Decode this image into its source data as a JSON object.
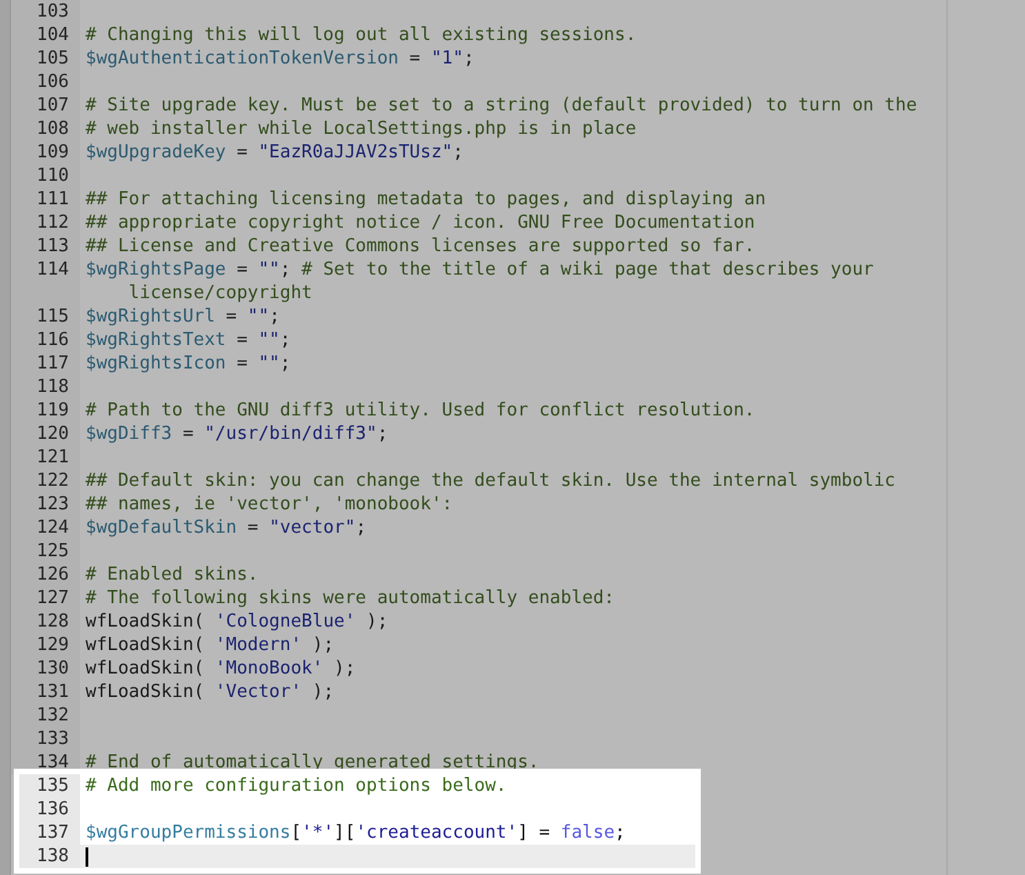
{
  "lines": [
    {
      "number": "103",
      "highlighted": false,
      "current": false
    },
    {
      "number": "104",
      "highlighted": false,
      "current": false,
      "segments": [
        {
          "kind": "comment",
          "text": "# Changing this will log out all existing sessions."
        }
      ]
    },
    {
      "number": "105",
      "highlighted": false,
      "current": false,
      "segments": [
        {
          "kind": "variable",
          "text": "$wgAuthenticationTokenVersion"
        },
        {
          "kind": "plain",
          "text": " = "
        },
        {
          "kind": "string",
          "text": "\"1\""
        },
        {
          "kind": "plain",
          "text": ";"
        }
      ]
    },
    {
      "number": "106",
      "highlighted": false,
      "current": false
    },
    {
      "number": "107",
      "highlighted": false,
      "current": false,
      "segments": [
        {
          "kind": "comment",
          "text": "# Site upgrade key. Must be set to a string (default provided) to turn on the"
        }
      ]
    },
    {
      "number": "108",
      "highlighted": false,
      "current": false,
      "segments": [
        {
          "kind": "comment",
          "text": "# web installer while LocalSettings.php is in place"
        }
      ]
    },
    {
      "number": "109",
      "highlighted": false,
      "current": false,
      "segments": [
        {
          "kind": "variable",
          "text": "$wgUpgradeKey"
        },
        {
          "kind": "plain",
          "text": " = "
        },
        {
          "kind": "string",
          "text": "\"EazR0aJJAV2sTUsz\""
        },
        {
          "kind": "plain",
          "text": ";"
        }
      ]
    },
    {
      "number": "110",
      "highlighted": false,
      "current": false
    },
    {
      "number": "111",
      "highlighted": false,
      "current": false,
      "segments": [
        {
          "kind": "comment",
          "text": "## For attaching licensing metadata to pages, and displaying an"
        }
      ]
    },
    {
      "number": "112",
      "highlighted": false,
      "current": false,
      "segments": [
        {
          "kind": "comment",
          "text": "## appropriate copyright notice / icon. GNU Free Documentation"
        }
      ]
    },
    {
      "number": "113",
      "highlighted": false,
      "current": false,
      "segments": [
        {
          "kind": "comment",
          "text": "## License and Creative Commons licenses are supported so far."
        }
      ]
    },
    {
      "number": "114",
      "highlighted": false,
      "current": false,
      "segments": [
        {
          "kind": "variable",
          "text": "$wgRightsPage"
        },
        {
          "kind": "plain",
          "text": " = "
        },
        {
          "kind": "string",
          "text": "\"\""
        },
        {
          "kind": "plain",
          "text": "; "
        },
        {
          "kind": "comment",
          "text": "# Set to the title of a wiki page that describes your"
        }
      ],
      "wrap": [
        {
          "kind": "comment",
          "text": "license/copyright"
        }
      ]
    },
    {
      "number": "115",
      "highlighted": false,
      "current": false,
      "segments": [
        {
          "kind": "variable",
          "text": "$wgRightsUrl"
        },
        {
          "kind": "plain",
          "text": " = "
        },
        {
          "kind": "string",
          "text": "\"\""
        },
        {
          "kind": "plain",
          "text": ";"
        }
      ]
    },
    {
      "number": "116",
      "highlighted": false,
      "current": false,
      "segments": [
        {
          "kind": "variable",
          "text": "$wgRightsText"
        },
        {
          "kind": "plain",
          "text": " = "
        },
        {
          "kind": "string",
          "text": "\"\""
        },
        {
          "kind": "plain",
          "text": ";"
        }
      ]
    },
    {
      "number": "117",
      "highlighted": false,
      "current": false,
      "segments": [
        {
          "kind": "variable",
          "text": "$wgRightsIcon"
        },
        {
          "kind": "plain",
          "text": " = "
        },
        {
          "kind": "string",
          "text": "\"\""
        },
        {
          "kind": "plain",
          "text": ";"
        }
      ]
    },
    {
      "number": "118",
      "highlighted": false,
      "current": false
    },
    {
      "number": "119",
      "highlighted": false,
      "current": false,
      "segments": [
        {
          "kind": "comment",
          "text": "# Path to the GNU diff3 utility. Used for conflict resolution."
        }
      ]
    },
    {
      "number": "120",
      "highlighted": false,
      "current": false,
      "segments": [
        {
          "kind": "variable",
          "text": "$wgDiff3"
        },
        {
          "kind": "plain",
          "text": " = "
        },
        {
          "kind": "string",
          "text": "\"/usr/bin/diff3\""
        },
        {
          "kind": "plain",
          "text": ";"
        }
      ]
    },
    {
      "number": "121",
      "highlighted": false,
      "current": false
    },
    {
      "number": "122",
      "highlighted": false,
      "current": false,
      "segments": [
        {
          "kind": "comment",
          "text": "## Default skin: you can change the default skin. Use the internal symbolic"
        }
      ]
    },
    {
      "number": "123",
      "highlighted": false,
      "current": false,
      "segments": [
        {
          "kind": "comment",
          "text": "## names, ie 'vector', 'monobook':"
        }
      ]
    },
    {
      "number": "124",
      "highlighted": false,
      "current": false,
      "segments": [
        {
          "kind": "variable",
          "text": "$wgDefaultSkin"
        },
        {
          "kind": "plain",
          "text": " = "
        },
        {
          "kind": "string",
          "text": "\"vector\""
        },
        {
          "kind": "plain",
          "text": ";"
        }
      ]
    },
    {
      "number": "125",
      "highlighted": false,
      "current": false
    },
    {
      "number": "126",
      "highlighted": false,
      "current": false,
      "segments": [
        {
          "kind": "comment",
          "text": "# Enabled skins."
        }
      ]
    },
    {
      "number": "127",
      "highlighted": false,
      "current": false,
      "segments": [
        {
          "kind": "comment",
          "text": "# The following skins were automatically enabled:"
        }
      ]
    },
    {
      "number": "128",
      "highlighted": false,
      "current": false,
      "segments": [
        {
          "kind": "plain",
          "text": "wfLoadSkin( "
        },
        {
          "kind": "string",
          "text": "'CologneBlue'"
        },
        {
          "kind": "plain",
          "text": " );"
        }
      ]
    },
    {
      "number": "129",
      "highlighted": false,
      "current": false,
      "segments": [
        {
          "kind": "plain",
          "text": "wfLoadSkin( "
        },
        {
          "kind": "string",
          "text": "'Modern'"
        },
        {
          "kind": "plain",
          "text": " );"
        }
      ]
    },
    {
      "number": "130",
      "highlighted": false,
      "current": false,
      "segments": [
        {
          "kind": "plain",
          "text": "wfLoadSkin( "
        },
        {
          "kind": "string",
          "text": "'MonoBook'"
        },
        {
          "kind": "plain",
          "text": " );"
        }
      ]
    },
    {
      "number": "131",
      "highlighted": false,
      "current": false,
      "segments": [
        {
          "kind": "plain",
          "text": "wfLoadSkin( "
        },
        {
          "kind": "string",
          "text": "'Vector'"
        },
        {
          "kind": "plain",
          "text": " );"
        }
      ]
    },
    {
      "number": "132",
      "highlighted": false,
      "current": false
    },
    {
      "number": "133",
      "highlighted": false,
      "current": false
    },
    {
      "number": "134",
      "highlighted": false,
      "current": false,
      "segments": [
        {
          "kind": "comment",
          "text": "# End of automatically generated settings."
        }
      ]
    },
    {
      "number": "135",
      "highlighted": true,
      "current": false,
      "segments": [
        {
          "kind": "comment",
          "text": "# Add more configuration options below."
        }
      ]
    },
    {
      "number": "136",
      "highlighted": true,
      "current": false
    },
    {
      "number": "137",
      "highlighted": true,
      "current": false,
      "segments": [
        {
          "kind": "variable",
          "text": "$wgGroupPermissions"
        },
        {
          "kind": "plain",
          "text": "["
        },
        {
          "kind": "string",
          "text": "'*'"
        },
        {
          "kind": "plain",
          "text": "]["
        },
        {
          "kind": "string",
          "text": "'createaccount'"
        },
        {
          "kind": "plain",
          "text": "] = "
        },
        {
          "kind": "keyword",
          "text": "false"
        },
        {
          "kind": "plain",
          "text": ";"
        }
      ]
    },
    {
      "number": "138",
      "highlighted": true,
      "current": true
    }
  ]
}
